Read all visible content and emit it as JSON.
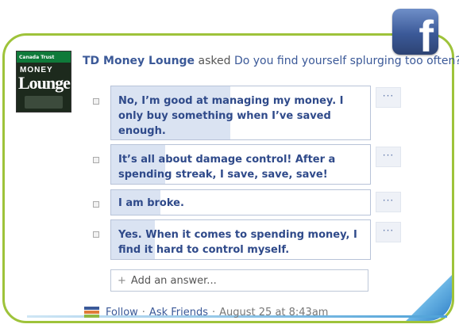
{
  "brand": {
    "fb_letter": "f"
  },
  "avatar": {
    "bank_text": "Canada Trust",
    "money_text": "MONEY",
    "lounge_text": "Lounge"
  },
  "post": {
    "page_name": "TD Money Lounge",
    "verb": "asked",
    "question": "Do you find yourself splurging too often?"
  },
  "answers": [
    {
      "text": "No, I’m good at managing my money. I only buy something when I’ve saved enough.",
      "more": "···",
      "vote_share": 0.46
    },
    {
      "text": "It’s all about damage control! After a spending streak, I save, save, save!",
      "more": "···",
      "vote_share": 0.21
    },
    {
      "text": "I am broke.",
      "more": "···",
      "vote_share": 0.19
    },
    {
      "text": "Yes. When it comes to spending money, I find it hard to control myself.",
      "more": "···",
      "vote_share": 0.17
    }
  ],
  "add_answer": {
    "plus": "+",
    "label": "Add an answer..."
  },
  "footer": {
    "follow": "Follow",
    "sep1": "·",
    "ask_friends": "Ask Friends",
    "sep2": "·",
    "date": "August 25 at 8:43am"
  },
  "colors": {
    "frame": "#9ec33a",
    "accent": "#2f7fc7",
    "link": "#3b5998",
    "answer_fill": "#dae3f2"
  }
}
